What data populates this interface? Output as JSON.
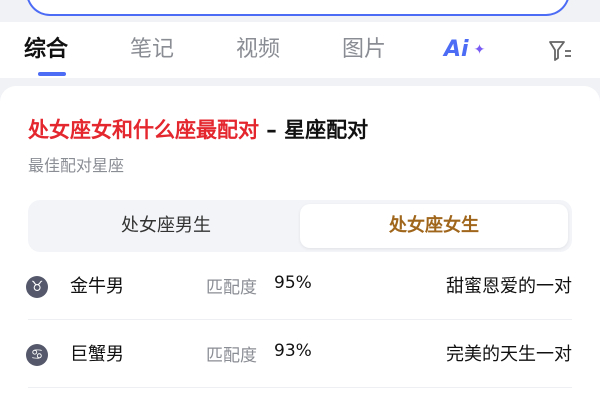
{
  "tabs": [
    {
      "label": "综合"
    },
    {
      "label": "笔记"
    },
    {
      "label": "视频"
    },
    {
      "label": "图片"
    }
  ],
  "ai_tab": {
    "label": "Ai"
  },
  "result": {
    "title_highlight": "处女座女和什么座最配对",
    "title_rest": " – 星座配对",
    "subtitle": "最佳配对星座",
    "segments": [
      "处女座男生",
      "处女座女生"
    ],
    "match_label": "匹配度",
    "items": [
      {
        "sign": "♉",
        "name": "金牛男",
        "score": "95%",
        "desc": "甜蜜恩爱的一对"
      },
      {
        "sign": "♋",
        "name": "巨蟹男",
        "score": "93%",
        "desc": "完美的天生一对"
      }
    ]
  },
  "colors": {
    "accent": "#4d6cf5",
    "highlight_red": "#e4262e",
    "segment_active": "#a0671c"
  }
}
